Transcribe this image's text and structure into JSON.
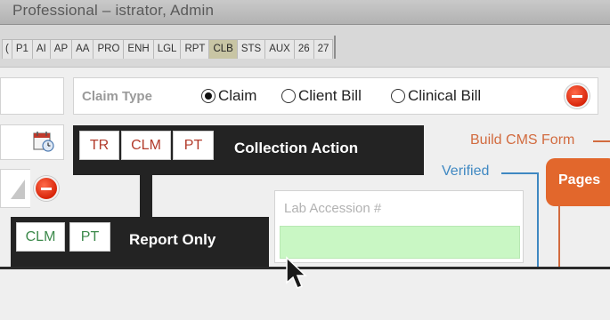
{
  "window": {
    "title": "Professional – istrator, Admin"
  },
  "tabs": [
    {
      "label": "(",
      "active": false
    },
    {
      "label": "P1",
      "active": false
    },
    {
      "label": "AI",
      "active": false
    },
    {
      "label": "AP",
      "active": false
    },
    {
      "label": "AA",
      "active": false
    },
    {
      "label": "PRO",
      "active": false
    },
    {
      "label": "ENH",
      "active": false
    },
    {
      "label": "LGL",
      "active": false
    },
    {
      "label": "RPT",
      "active": false
    },
    {
      "label": "CLB",
      "active": true
    },
    {
      "label": "STS",
      "active": false
    },
    {
      "label": "AUX",
      "active": false
    },
    {
      "label": "26",
      "active": false
    },
    {
      "label": "27",
      "active": false
    }
  ],
  "claim_type": {
    "label": "Claim Type",
    "options": [
      "Claim",
      "Client Bill",
      "Clinical Bill"
    ],
    "selected": "Claim"
  },
  "collection_action": {
    "title": "Collection Action",
    "buttons": [
      "TR",
      "CLM",
      "PT"
    ],
    "button_colors": [
      "#b23a2a",
      "#b23a2a",
      "#b23a2a"
    ]
  },
  "report_only": {
    "title": "Report Only",
    "buttons": [
      "CLM",
      "PT"
    ],
    "button_colors": [
      "#3d8a4c",
      "#3d8a4c"
    ]
  },
  "lab_accession": {
    "placeholder": "Lab Accession #",
    "value": ""
  },
  "workflow": {
    "build_cms_form": "Build CMS Form",
    "verified": "Verified",
    "pages": "Pages"
  },
  "colors": {
    "accent_orange": "#e2672c",
    "accent_blue": "#3f88c2",
    "active_tab": "#c8c5a4",
    "input_green": "#c9f7c4",
    "remove_red": "#d8250a"
  },
  "icons": {
    "calendar": "calendar-clock-icon",
    "remove": "remove-circle-icon",
    "cursor": "mouse-pointer-icon"
  }
}
